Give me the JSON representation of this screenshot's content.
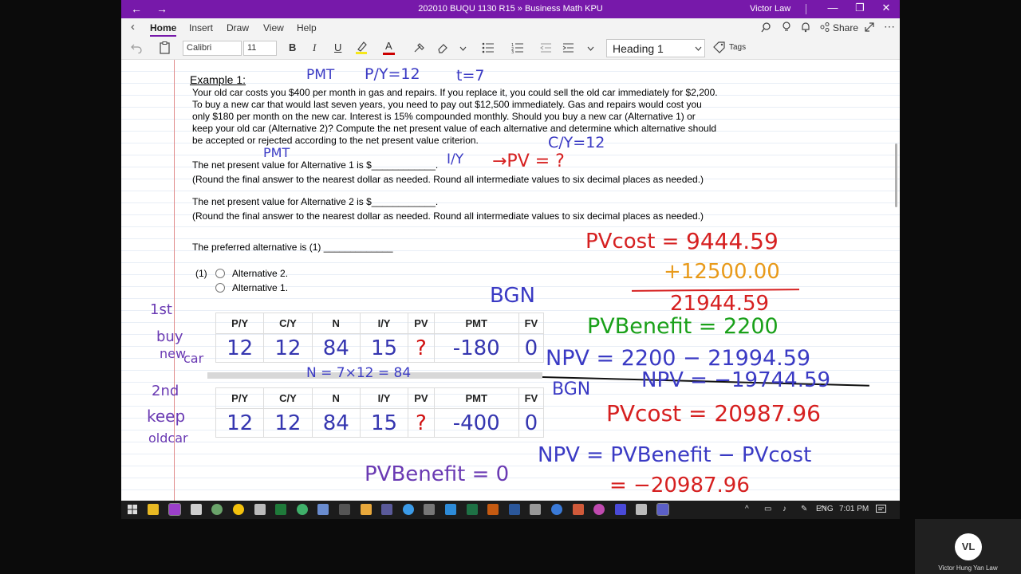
{
  "window": {
    "title": "202010 BUQU 1130 R15 » Business Math KPU",
    "user": "Victor Law",
    "back_glyph": "←",
    "forward_glyph": "→",
    "minimize_glyph": "—",
    "restore_glyph": "❐",
    "close_glyph": "✕",
    "accent": "#7719aa"
  },
  "ribbon": {
    "tabs": [
      "Home",
      "Insert",
      "Draw",
      "View",
      "Help"
    ],
    "active_tab": "Home",
    "share_label": "Share",
    "font": "Calibri",
    "size": "11",
    "bold": "B",
    "italic": "I",
    "underline": "U",
    "font_color": "A",
    "style": "Heading 1",
    "tags_label": "Tags"
  },
  "note": {
    "heading": "Example 1:",
    "paragraph": "Your old car costs you $400 per month in gas and repairs. If you replace it, you could sell the old car immediately for $2,200. To buy a new car that would last seven years, you need to pay out $12,500 immediately. Gas and repairs would cost you only $180 per month on the new car. Interest is 15% compounded monthly. Should you buy a new car (Alternative 1) or keep your old car (Alternative 2)? Compute the net present value of each alternative and determine which alternative should be accepted or rejected according to the net present value criterion.",
    "q1": "The net present value for Alternative 1 is $",
    "q1_blank": "____________.",
    "q2": "The net present value for Alternative 2 is $",
    "q2_blank": "____________.",
    "round_note": "(Round the final answer to the nearest dollar as needed. Round all intermediate values to six decimal places as needed.)",
    "preferred": "The preferred alternative is  (1)",
    "preferred_blank": "_____________",
    "choice_label": "(1)",
    "options": [
      "Alternative 2.",
      "Alternative 1."
    ]
  },
  "tables": [
    {
      "headers": [
        "P/Y",
        "C/Y",
        "N",
        "I/Y",
        "PV",
        "PMT",
        "FV"
      ],
      "values": [
        "12",
        "12",
        "84",
        "15",
        "?",
        "-180",
        "0"
      ]
    },
    {
      "headers": [
        "P/Y",
        "C/Y",
        "N",
        "I/Y",
        "PV",
        "PMT",
        "FV"
      ],
      "values": [
        "12",
        "12",
        "84",
        "15",
        "?",
        "-400",
        "0"
      ]
    }
  ],
  "ink": {
    "pmt_top": "PMT",
    "py_top": "P/Y=12",
    "t_top": "t=7",
    "cy_mid": "C/Y=12",
    "pmt_mid": "PMT",
    "iy_mid": "I/Y",
    "pv_q": "→PV = ?",
    "label_1st": "1st",
    "label_buy": "buy",
    "label_new": "new",
    "label_car": "car",
    "label_2nd": "2nd",
    "label_keep": "keep",
    "label_oldcar": "oldcar",
    "n_calc": "N = 7×12 = 84",
    "bgn1": "BGN",
    "bgn2": "BGN",
    "pvcost1": "PVcost =",
    "pvcost1_val": "9444.59",
    "pvcost1_add": "+12500.00",
    "pvcost1_sum": "21944.59",
    "pvbenefit": "PVBenefit = 2200",
    "npv1": "NPV = 2200 − 21994.59",
    "npv1_res": "NPV = −19744.59",
    "pvcost2": "PVcost = 20987.96",
    "npv2": "NPV = PVBenefit − PVcost",
    "npv2_res": "= −20987.96",
    "pvbenefit2": "PVBenefit = 0"
  },
  "taskbar": {
    "lang": "ENG",
    "time": "7:01 PM"
  },
  "webcam": {
    "initials": "VL",
    "name": "Victor Hung Yan Law"
  }
}
